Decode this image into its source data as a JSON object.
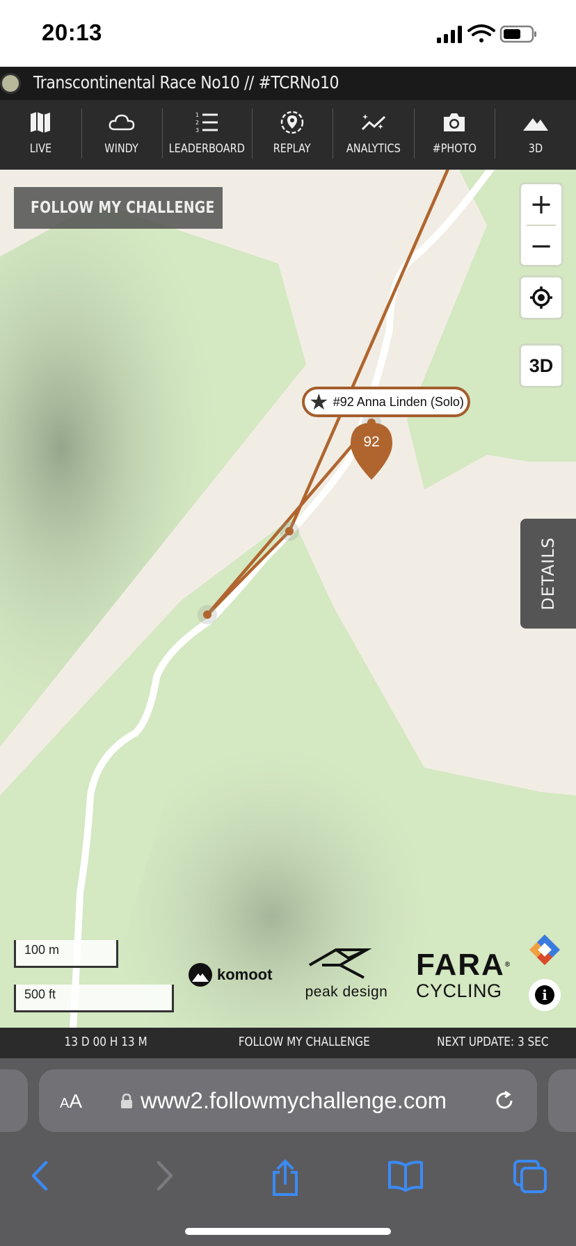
{
  "status_bar": {
    "time": "20:13"
  },
  "app": {
    "title": "Transcontinental Race No10 // #TCRNo10",
    "nav": [
      {
        "label": "LIVE",
        "icon": "map-icon"
      },
      {
        "label": "WINDY",
        "icon": "cloud-icon"
      },
      {
        "label": "LEADERBOARD",
        "icon": "list-numbered-icon"
      },
      {
        "label": "REPLAY",
        "icon": "location-pin-circle-icon"
      },
      {
        "label": "ANALYTICS",
        "icon": "analytics-chart-icon"
      },
      {
        "label": "#PHOTO",
        "icon": "camera-icon"
      },
      {
        "label": "3D",
        "icon": "mountain-icon"
      }
    ]
  },
  "map": {
    "badge_text": "FOLLOW MY CHALLENGE",
    "zoom_in": "+",
    "zoom_out": "−",
    "three_d_label": "3D",
    "rider_label": "#92 Anna Linden (Solo)",
    "rider_number": "92",
    "rider_color": "#b0652e",
    "details_label": "DETAILS",
    "scale_metric": "100 m",
    "scale_imperial": "500 ft",
    "sponsors": {
      "komoot": "komoot",
      "peak_design": "peak design",
      "fara_line1": "FARA",
      "fara_line2": "CYCLING"
    },
    "info_label": "i"
  },
  "footer": {
    "elapsed": "13 D 00 H 13 M",
    "center": "FOLLOW MY CHALLENGE",
    "next_update": "NEXT UPDATE: 3 SEC"
  },
  "browser": {
    "aa_small": "A",
    "aa_large": "A",
    "url": "www2.followmychallenge.com"
  }
}
